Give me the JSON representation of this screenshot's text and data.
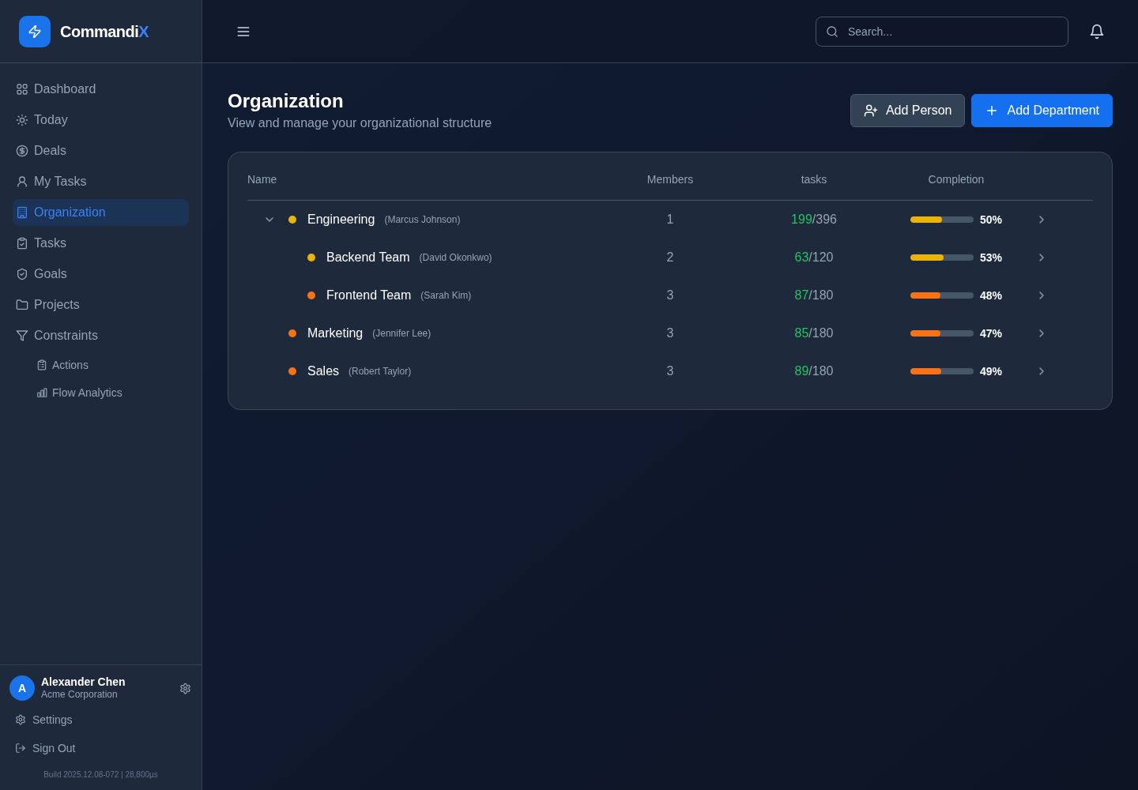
{
  "sidebar": {
    "brand": {
      "name": "Commandi",
      "accent": "X"
    },
    "items": [
      {
        "label": "Dashboard",
        "selected": false
      },
      {
        "label": "Today",
        "selected": false
      },
      {
        "label": "Deals",
        "selected": false
      },
      {
        "label": "My Tasks",
        "selected": false
      },
      {
        "label": "Organization",
        "selected": true
      },
      {
        "label": "Tasks",
        "selected": false
      },
      {
        "label": "Goals",
        "selected": false
      },
      {
        "label": "Projects",
        "selected": false
      },
      {
        "label": "Constraints",
        "selected": false,
        "children": [
          {
            "label": "Actions",
            "selected": false
          },
          {
            "label": "Flow Analytics",
            "selected": false
          }
        ]
      }
    ],
    "user": {
      "initial": "A",
      "name": "Alexander Chen",
      "company": "Acme Corporation"
    },
    "footer_links": [
      "Settings",
      "Sign Out"
    ],
    "build": "Build 2025.12.08-072 | 28,800µs"
  },
  "header": {
    "search": {
      "placeholder": "Search..."
    }
  },
  "page": {
    "title": "Organization",
    "subtitle": "View and manage your organizational structure",
    "actions": [
      {
        "label": "Add Person",
        "kind": "secondary"
      },
      {
        "label": "Add Department",
        "kind": "primary"
      }
    ]
  },
  "table": {
    "columns": [
      "Name",
      "Members",
      "tasks",
      "Completion"
    ],
    "rows": [
      {
        "name": "Engineering",
        "manager": "(Marcus Johnson)",
        "color": "#eab308",
        "members": "1",
        "tasks_done": "199",
        "tasks_total": "/396",
        "level": 0.5,
        "completion": "50%",
        "expanded": true,
        "children": [
          {
            "name": "Backend Team",
            "manager": "(David Okonkwo)",
            "color": "#eab308",
            "members": "2",
            "tasks_done": "63",
            "tasks_total": "/120",
            "level": 0.53,
            "completion": "53%"
          },
          {
            "name": "Frontend Team",
            "manager": "(Sarah Kim)",
            "color": "#f97316",
            "members": "3",
            "tasks_done": "87",
            "tasks_total": "/180",
            "level": 0.48,
            "completion": "48%"
          }
        ]
      },
      {
        "name": "Marketing",
        "manager": "(Jennifer Lee)",
        "color": "#f97316",
        "members": "3",
        "tasks_done": "85",
        "tasks_total": "/180",
        "level": 0.47,
        "completion": "47%"
      },
      {
        "name": "Sales",
        "manager": "(Robert Taylor)",
        "color": "#f97316",
        "members": "3",
        "tasks_done": "89",
        "tasks_total": "/180",
        "level": 0.49,
        "completion": "49%"
      }
    ]
  }
}
